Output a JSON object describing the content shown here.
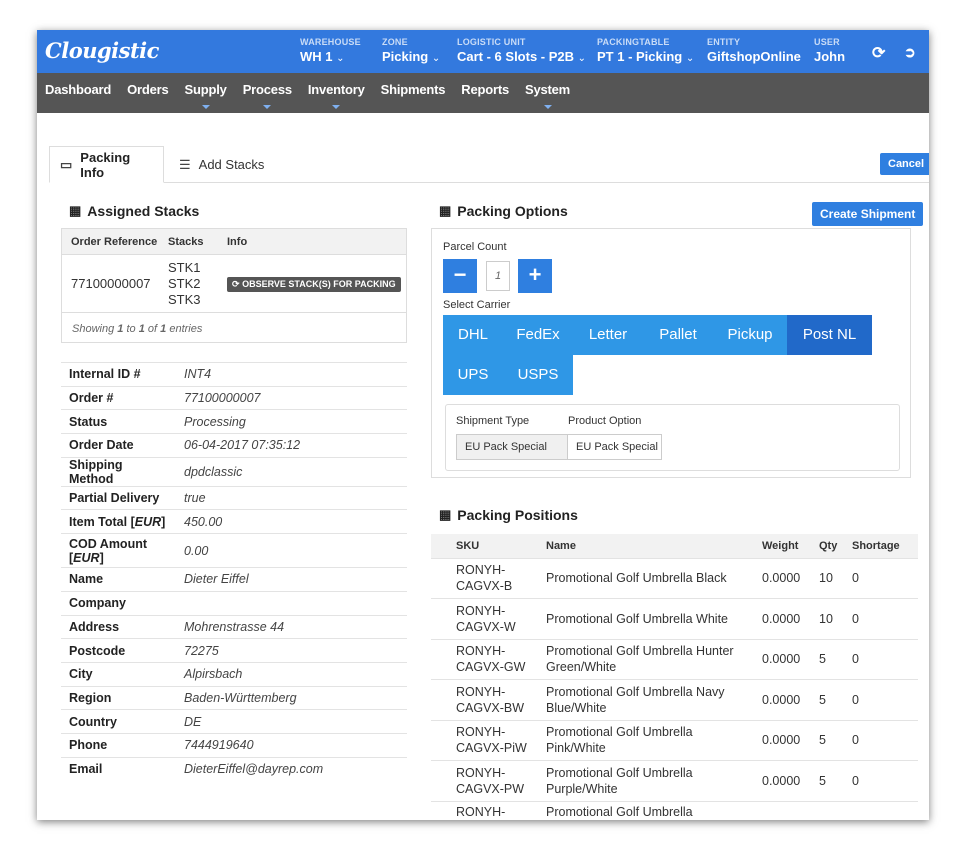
{
  "header": {
    "logo": "Clougistic",
    "contexts": [
      {
        "label": "WAREHOUSE",
        "value": "WH 1",
        "dropdown": true
      },
      {
        "label": "ZONE",
        "value": "Picking",
        "dropdown": true
      },
      {
        "label": "LOGISTIC UNIT",
        "value": "Cart - 6 Slots - P2B",
        "dropdown": true
      },
      {
        "label": "PACKINGTABLE",
        "value": "PT 1 - Picking",
        "dropdown": true
      },
      {
        "label": "ENTITY",
        "value": "GiftshopOnline",
        "dropdown": false
      },
      {
        "label": "USER",
        "value": "John",
        "dropdown": false
      }
    ],
    "icons": [
      "refresh-icon",
      "logout-icon"
    ]
  },
  "nav": {
    "items": [
      {
        "label": "Dashboard",
        "dropdown": false
      },
      {
        "label": "Orders",
        "dropdown": false
      },
      {
        "label": "Supply",
        "dropdown": true
      },
      {
        "label": "Process",
        "dropdown": true
      },
      {
        "label": "Inventory",
        "dropdown": true
      },
      {
        "label": "Shipments",
        "dropdown": false
      },
      {
        "label": "Reports",
        "dropdown": false
      },
      {
        "label": "System",
        "dropdown": true
      }
    ]
  },
  "tabs": [
    {
      "label": "Packing Info",
      "active": true,
      "icon": "inbox-icon"
    },
    {
      "label": "Add Stacks",
      "active": false,
      "icon": "database-icon"
    }
  ],
  "cancel_label": "Cancel",
  "assigned_stacks": {
    "title": "Assigned Stacks",
    "columns": [
      "Order Reference",
      "Stacks",
      "Info"
    ],
    "rows": [
      {
        "order_ref": "77100000007",
        "stacks": [
          "STK1",
          "STK2",
          "STK3"
        ],
        "action": "OBSERVE STACK(S) FOR PACKING"
      }
    ],
    "showing": {
      "prefix": "Showing",
      "from": "1",
      "to_word": "to",
      "to": "1",
      "of_word": "of",
      "total": "1",
      "suffix": "entries"
    }
  },
  "order_info": [
    {
      "key": "Internal ID #",
      "value": "INT4"
    },
    {
      "key": "Order #",
      "value": "77100000007"
    },
    {
      "key": "Status",
      "value": "Processing"
    },
    {
      "key": "Order Date",
      "value": "06-04-2017 07:35:12"
    },
    {
      "key": "Shipping Method",
      "value": "dpdclassic"
    },
    {
      "key": "Partial Delivery",
      "value": "true"
    },
    {
      "key": "Item Total",
      "key_unit": "EUR",
      "value": "450.00"
    },
    {
      "key": "COD Amount",
      "key_unit": "EUR",
      "value": "0.00"
    },
    {
      "key": "Name",
      "value": "Dieter  Eiffel"
    },
    {
      "key": "Company",
      "value": ""
    },
    {
      "key": "Address",
      "value": "Mohrenstrasse  44"
    },
    {
      "key": "Postcode",
      "value": "72275"
    },
    {
      "key": "City",
      "value": "Alpirsbach"
    },
    {
      "key": "Region",
      "value": "Baden-Württemberg"
    },
    {
      "key": "Country",
      "value": "DE"
    },
    {
      "key": "Phone",
      "value": "7444919640"
    },
    {
      "key": "Email",
      "value": "DieterEiffel@dayrep.com"
    }
  ],
  "packing_options": {
    "title": "Packing Options",
    "create_label": "Create Shipment",
    "parcel_count_label": "Parcel Count",
    "parcel_count": "1",
    "minus": "−",
    "plus": "+",
    "select_carrier_label": "Select Carrier",
    "carriers": [
      {
        "label": "DHL",
        "selected": false
      },
      {
        "label": "FedEx",
        "selected": false
      },
      {
        "label": "Letter",
        "selected": false
      },
      {
        "label": "Pallet",
        "selected": false
      },
      {
        "label": "Pickup",
        "selected": false
      },
      {
        "label": "Post NL",
        "selected": true
      },
      {
        "label": "UPS",
        "selected": false
      },
      {
        "label": "USPS",
        "selected": false
      }
    ],
    "shipment_type_label": "Shipment Type",
    "shipment_type": "EU Pack Special",
    "product_option_label": "Product Option",
    "product_option": "EU Pack Special ("
  },
  "packing_positions": {
    "title": "Packing Positions",
    "columns": [
      "SKU",
      "Name",
      "Weight",
      "Qty",
      "Shortage"
    ],
    "rows": [
      {
        "sku": "RONYH-CAGVX-B",
        "name": "Promotional Golf Umbrella Black",
        "weight": "0.0000",
        "qty": "10",
        "shortage": "0"
      },
      {
        "sku": "RONYH-CAGVX-W",
        "name": "Promotional Golf Umbrella White",
        "weight": "0.0000",
        "qty": "10",
        "shortage": "0"
      },
      {
        "sku": "RONYH-CAGVX-GW",
        "name": "Promotional Golf Umbrella Hunter Green/White",
        "weight": "0.0000",
        "qty": "5",
        "shortage": "0"
      },
      {
        "sku": "RONYH-CAGVX-BW",
        "name": "Promotional Golf Umbrella Navy Blue/White",
        "weight": "0.0000",
        "qty": "5",
        "shortage": "0"
      },
      {
        "sku": "RONYH-CAGVX-PiW",
        "name": "Promotional Golf Umbrella Pink/White",
        "weight": "0.0000",
        "qty": "5",
        "shortage": "0"
      },
      {
        "sku": "RONYH-CAGVX-PW",
        "name": "Promotional Golf Umbrella Purple/White",
        "weight": "0.0000",
        "qty": "5",
        "shortage": "0"
      },
      {
        "sku": "RONYH-",
        "name": "Promotional Golf Umbrella",
        "weight": "",
        "qty": "",
        "shortage": ""
      }
    ]
  },
  "colors": {
    "brand": "#3379de",
    "nav": "#555555",
    "carrier": "#2f97e6",
    "carrier_selected": "#2169c9"
  }
}
